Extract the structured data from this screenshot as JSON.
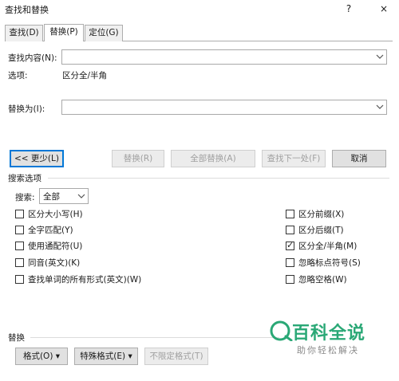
{
  "window": {
    "title": "查找和替换",
    "help_glyph": "?",
    "close_glyph": "×"
  },
  "tabs": [
    {
      "label": "查找(D)"
    },
    {
      "label": "替换(P)"
    },
    {
      "label": "定位(G)"
    }
  ],
  "find": {
    "label": "查找内容(N):",
    "value": ""
  },
  "options": {
    "label": "选项:",
    "value": "区分全/半角"
  },
  "replace": {
    "label": "替换为(I):",
    "value": ""
  },
  "buttons": {
    "less": "<< 更少(L)",
    "replace": "替换(R)",
    "replace_all": "全部替换(A)",
    "find_next": "查找下一处(F)",
    "cancel": "取消"
  },
  "search_options": {
    "section_label": "搜索选项",
    "search_label": "搜索:",
    "search_value": "全部",
    "left": [
      {
        "label": "区分大小写(H)",
        "checked": false
      },
      {
        "label": "全字匹配(Y)",
        "checked": false
      },
      {
        "label": "使用通配符(U)",
        "checked": false
      },
      {
        "label": "同音(英文)(K)",
        "checked": false
      },
      {
        "label": "查找单词的所有形式(英文)(W)",
        "checked": false
      }
    ],
    "right": [
      {
        "label": "区分前缀(X)",
        "checked": false
      },
      {
        "label": "区分后缀(T)",
        "checked": false
      },
      {
        "label": "区分全/半角(M)",
        "checked": true
      },
      {
        "label": "忽略标点符号(S)",
        "checked": false
      },
      {
        "label": "忽略空格(W)",
        "checked": false
      }
    ]
  },
  "replace_section": {
    "label": "替换",
    "format": "格式(O)",
    "special": "特殊格式(E)",
    "no_format": "不限定格式(T)"
  },
  "watermark": {
    "title": "百科全说",
    "subtitle": "助你轻松解决",
    "color": "#2aa876"
  },
  "check_glyph": "✓",
  "dropdown_glyph": "▾"
}
